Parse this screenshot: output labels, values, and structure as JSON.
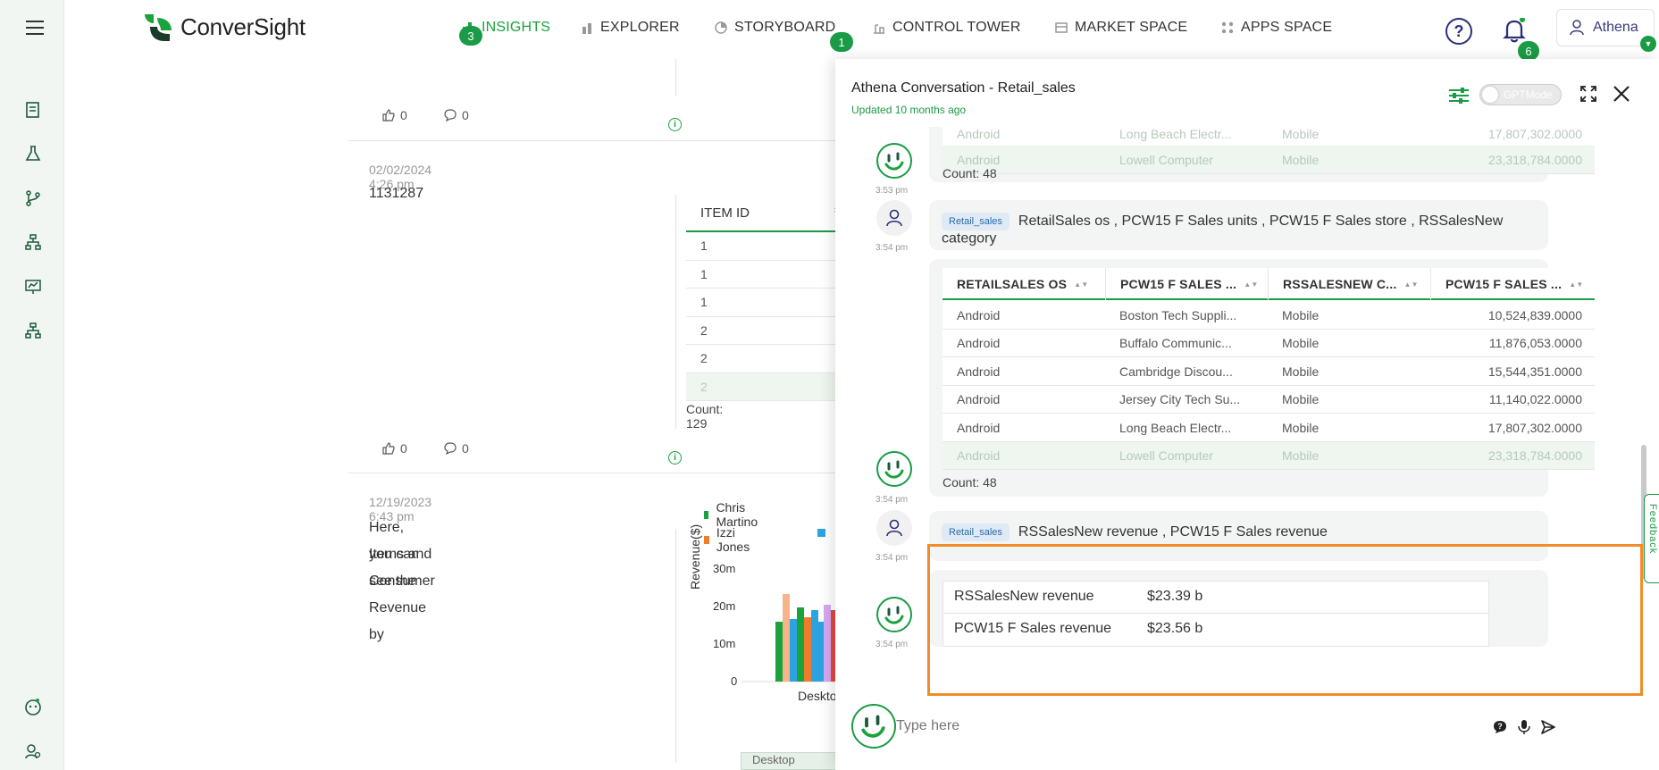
{
  "app": {
    "brand": "ConverSight"
  },
  "nav": {
    "items": [
      {
        "label": "INSIGHTS",
        "badge": "3",
        "active": true
      },
      {
        "label": "EXPLORER"
      },
      {
        "label": "STORYBOARD",
        "badge": "1"
      },
      {
        "label": "CONTROL TOWER"
      },
      {
        "label": "MARKET SPACE"
      },
      {
        "label": "APPS SPACE"
      }
    ],
    "notifications_badge": "6",
    "user_name": "Athena"
  },
  "feed": {
    "posts": [
      {
        "likes": "0",
        "comments": "0"
      },
      {
        "date": "02/02/2024 4:26 pm",
        "text": "1131287",
        "table_header": "ITEM ID",
        "table_rows": [
          "1",
          "1",
          "1",
          "2",
          "2",
          "2"
        ],
        "count": "Count: 129",
        "likes": "0",
        "comments": "0"
      },
      {
        "date": "12/19/2023 6:43 pm",
        "text_line1": "Here, you can see the Revenue by",
        "text_line2": "Items and Consumer",
        "legend": [
          "Chris Martino",
          "Izzi Jones"
        ],
        "y_axis_label": "Revenue($)",
        "y_ticks": [
          "30m",
          "20m",
          "10m",
          "0"
        ],
        "x_tick": "Desktop",
        "scroller_label": "Desktop"
      }
    ]
  },
  "panel": {
    "title": "Athena Conversation - Retail_sales",
    "subtitle": "Updated 10 months ago",
    "gpt_mode": "GPTMode",
    "top_partial_rows": [
      {
        "os": "Android",
        "store": "Long Beach Electr...",
        "category": "Mobile",
        "units": "17,807,302.0000"
      },
      {
        "os": "Android",
        "store": "Lowell Computer",
        "category": "Mobile",
        "units": "23,318,784.0000"
      }
    ],
    "first_count": "Count: 48",
    "first_time": "3:53 pm",
    "query1": {
      "tag": "Retail_sales",
      "text": "RetailSales os , PCW15 F Sales units , PCW15 F Sales store , RSSalesNew category",
      "time": "3:54 pm"
    },
    "table": {
      "headers": [
        "RETAILSALES OS",
        "PCW15 F SALES ...",
        "RSSALESNEW C...",
        "PCW15 F SALES ..."
      ],
      "rows": [
        [
          "Android",
          "Boston Tech Suppli...",
          "Mobile",
          "10,524,839.0000"
        ],
        [
          "Android",
          "Buffalo Communic...",
          "Mobile",
          "11,876,053.0000"
        ],
        [
          "Android",
          "Cambridge Discou...",
          "Mobile",
          "15,544,351.0000"
        ],
        [
          "Android",
          "Jersey City Tech Su...",
          "Mobile",
          "11,140,022.0000"
        ],
        [
          "Android",
          "Long Beach Electr...",
          "Mobile",
          "17,807,302.0000"
        ],
        [
          "Android",
          "Lowell Computer",
          "Mobile",
          "23,318,784.0000"
        ]
      ],
      "count": "Count: 48",
      "time": "3:54 pm"
    },
    "query2": {
      "tag": "Retail_sales",
      "text": "RSSalesNew revenue , PCW15 F Sales revenue",
      "time": "3:54 pm"
    },
    "kv": [
      {
        "key": "RSSalesNew revenue",
        "value": "$23.39 b"
      },
      {
        "key": "PCW15 F Sales revenue",
        "value": "$23.56 b"
      }
    ],
    "kv_time": "3:54 pm",
    "input_placeholder": "Type here",
    "feedback": "Feedback"
  },
  "colors": {
    "brand_green": "#1a9b45",
    "highlight_orange": "#f28c28",
    "chart_colors": [
      "#1aa23c",
      "#f7b48a",
      "#2ba3e0",
      "#f07c2b",
      "#d6a6f2",
      "#e0483c"
    ]
  }
}
